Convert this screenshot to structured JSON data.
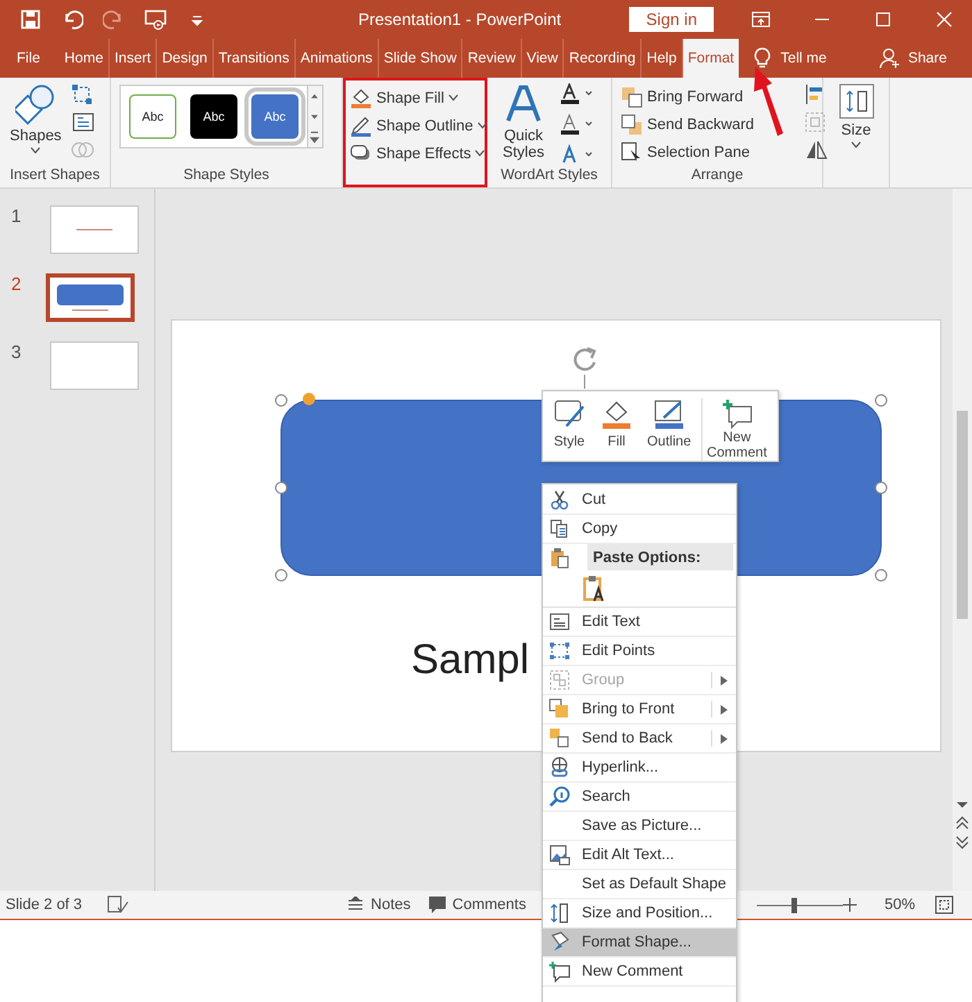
{
  "title_bar": {
    "title": "Presentation1  -  PowerPoint",
    "sign_in": "Sign in"
  },
  "tabs": [
    {
      "label": "File",
      "selected": false
    },
    {
      "label": "Home",
      "selected": false
    },
    {
      "label": "Insert",
      "selected": false
    },
    {
      "label": "Design",
      "selected": false
    },
    {
      "label": "Transitions",
      "selected": false
    },
    {
      "label": "Animations",
      "selected": false
    },
    {
      "label": "Slide Show",
      "selected": false
    },
    {
      "label": "Review",
      "selected": false
    },
    {
      "label": "View",
      "selected": false
    },
    {
      "label": "Recording",
      "selected": false
    },
    {
      "label": "Help",
      "selected": false
    },
    {
      "label": "Format",
      "selected": true
    }
  ],
  "tell_me": "Tell me",
  "share": "Share",
  "insert_shapes": {
    "button": "Shapes",
    "label": "Insert Shapes"
  },
  "shape_styles": {
    "label": "Shape Styles",
    "swatches": [
      {
        "text": "Abc",
        "kind": "outline",
        "selected": false
      },
      {
        "text": "Abc",
        "kind": "dark",
        "selected": false
      },
      {
        "text": "Abc",
        "kind": "accent",
        "selected": true
      }
    ]
  },
  "shape_format": {
    "highlighted": true,
    "commands": [
      "Shape Fill",
      "Shape Outline",
      "Shape Effects"
    ]
  },
  "wordart": {
    "button": "Quick Styles",
    "label": "WordArt Styles"
  },
  "arrange": {
    "label": "Arrange",
    "commands": [
      "Bring Forward",
      "Send Backward",
      "Selection Pane"
    ]
  },
  "size": {
    "button": "Size"
  },
  "slides": [
    {
      "number": "1",
      "selected": false
    },
    {
      "number": "2",
      "selected": true
    },
    {
      "number": "3",
      "selected": false
    }
  ],
  "slide": {
    "text": "Sampl"
  },
  "mini_toolbar": {
    "buttons": [
      "Style",
      "Fill",
      "Outline",
      "New Comment"
    ]
  },
  "context_menu": [
    {
      "kind": "item",
      "label": "Cut",
      "disabled": false,
      "submenu": false,
      "selected": false
    },
    {
      "kind": "item",
      "label": "Copy",
      "disabled": false,
      "submenu": false,
      "selected": false
    },
    {
      "kind": "header",
      "label": "Paste Options:"
    },
    {
      "kind": "paste"
    },
    {
      "kind": "item",
      "label": "Edit Text",
      "disabled": false,
      "submenu": false,
      "selected": false
    },
    {
      "kind": "item",
      "label": "Edit Points",
      "disabled": false,
      "submenu": false,
      "selected": false
    },
    {
      "kind": "item",
      "label": "Group",
      "disabled": true,
      "submenu": true,
      "selected": false
    },
    {
      "kind": "item",
      "label": "Bring to Front",
      "disabled": false,
      "submenu": true,
      "selected": false
    },
    {
      "kind": "item",
      "label": "Send to Back",
      "disabled": false,
      "submenu": true,
      "selected": false
    },
    {
      "kind": "item",
      "label": "Hyperlink...",
      "disabled": false,
      "submenu": false,
      "selected": false
    },
    {
      "kind": "item",
      "label": "Search",
      "disabled": false,
      "submenu": false,
      "selected": false
    },
    {
      "kind": "item",
      "label": "Save as Picture...",
      "disabled": false,
      "submenu": false,
      "selected": false
    },
    {
      "kind": "item",
      "label": "Edit Alt Text...",
      "disabled": false,
      "submenu": false,
      "selected": false
    },
    {
      "kind": "item",
      "label": "Set as Default Shape",
      "disabled": false,
      "submenu": false,
      "selected": false
    },
    {
      "kind": "item",
      "label": "Size and Position...",
      "disabled": false,
      "submenu": false,
      "selected": false
    },
    {
      "kind": "item",
      "label": "Format Shape...",
      "disabled": false,
      "submenu": false,
      "selected": true
    },
    {
      "kind": "item",
      "label": "New Comment",
      "disabled": false,
      "submenu": false,
      "selected": false
    }
  ],
  "status_bar": {
    "slide_info": "Slide 2 of 3",
    "notes": "Notes",
    "comments": "Comments",
    "zoom": {
      "level": 0.4
    },
    "zoom_text": "50%"
  }
}
